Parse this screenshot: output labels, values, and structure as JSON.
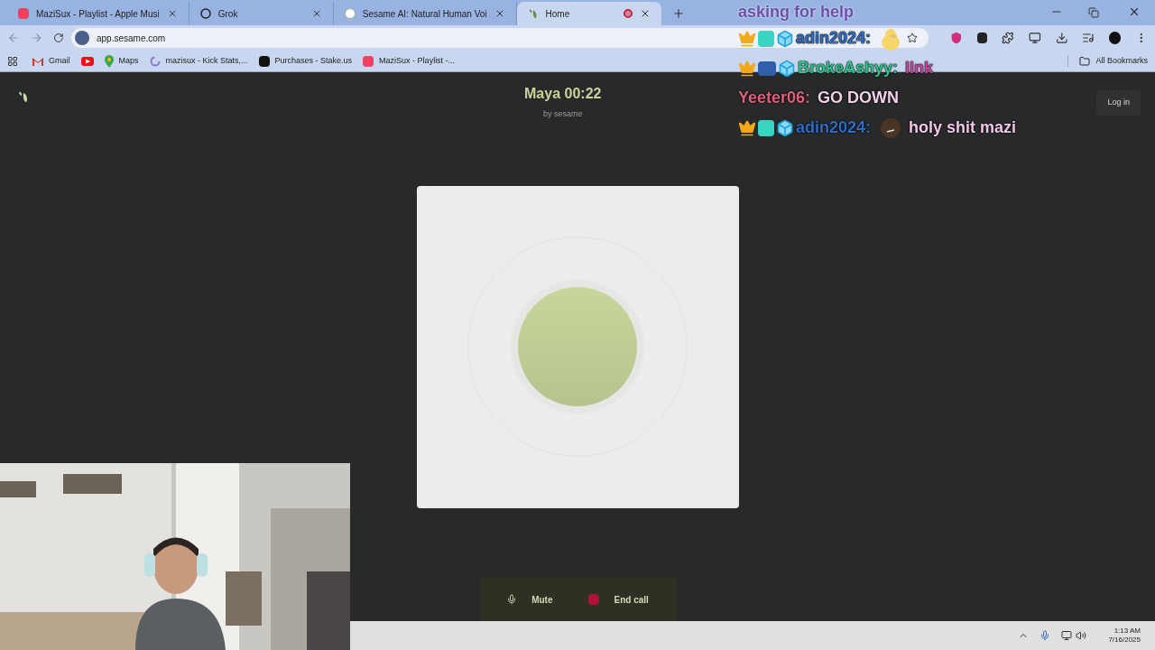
{
  "browser": {
    "tabs": [
      {
        "title": "MaziSux - Playlist - Apple Musi",
        "kind": "music",
        "selected": false,
        "recording": false
      },
      {
        "title": "Grok",
        "kind": "grok",
        "selected": false,
        "recording": false
      },
      {
        "title": "Sesame AI: Natural Human Voi",
        "kind": "sesame",
        "selected": false,
        "recording": false
      },
      {
        "title": "Home",
        "kind": "leaf",
        "selected": true,
        "recording": true
      }
    ],
    "address": "app.sesame.com",
    "bookmarks": [
      {
        "kind": "mail",
        "label": "Gmail"
      },
      {
        "kind": "video"
      },
      {
        "kind": "pin",
        "label": "Maps"
      },
      {
        "kind": "ring",
        "label": "mazisux - Kick Stats,..."
      },
      {
        "kind": "square",
        "label": "Purchases - Stake.us"
      },
      {
        "kind": "music",
        "label": "MaziSux - Playlist -..."
      }
    ],
    "all_bookmarks": "All Bookmarks"
  },
  "page": {
    "agent": "Maya",
    "timer": "00:22",
    "byline": "by sesame",
    "login": "Log in",
    "controls": [
      {
        "kind": "mute",
        "label": "Mute"
      },
      {
        "kind": "end",
        "label": "End call"
      }
    ]
  },
  "taskbar": {
    "time": "1:13 AM",
    "date": "7/16/2025"
  },
  "overlay": {
    "title": "asking for help",
    "chat": [
      {
        "badges": [
          {
            "kind": "crown"
          },
          {
            "kind": "og"
          },
          {
            "kind": "cube"
          }
        ],
        "user": {
          "name": "adin2024:",
          "color": "#2f6cc4"
        },
        "emote": {
          "kind": "duck"
        }
      },
      {
        "badges": [
          {
            "kind": "crown"
          },
          {
            "kind": "mbg"
          },
          {
            "kind": "cube"
          }
        ],
        "user": {
          "name": "BrokeAshyy:",
          "color": "#2ec48c"
        },
        "message": {
          "text": "link",
          "color": "#c8479e"
        }
      },
      {
        "user": {
          "name": "Yeeter06:",
          "color": "#e0607c"
        },
        "message": {
          "text": "GO DOWN",
          "color": "#f2d2ea"
        }
      },
      {
        "badges": [
          {
            "kind": "crown"
          },
          {
            "kind": "og"
          },
          {
            "kind": "cube"
          }
        ],
        "user": {
          "name": "adin2024:",
          "color": "#2f6cc4"
        },
        "emote": {
          "kind": "face"
        },
        "message": {
          "text": "holy shit mazi",
          "color": "#f0c8e6"
        }
      }
    ]
  }
}
